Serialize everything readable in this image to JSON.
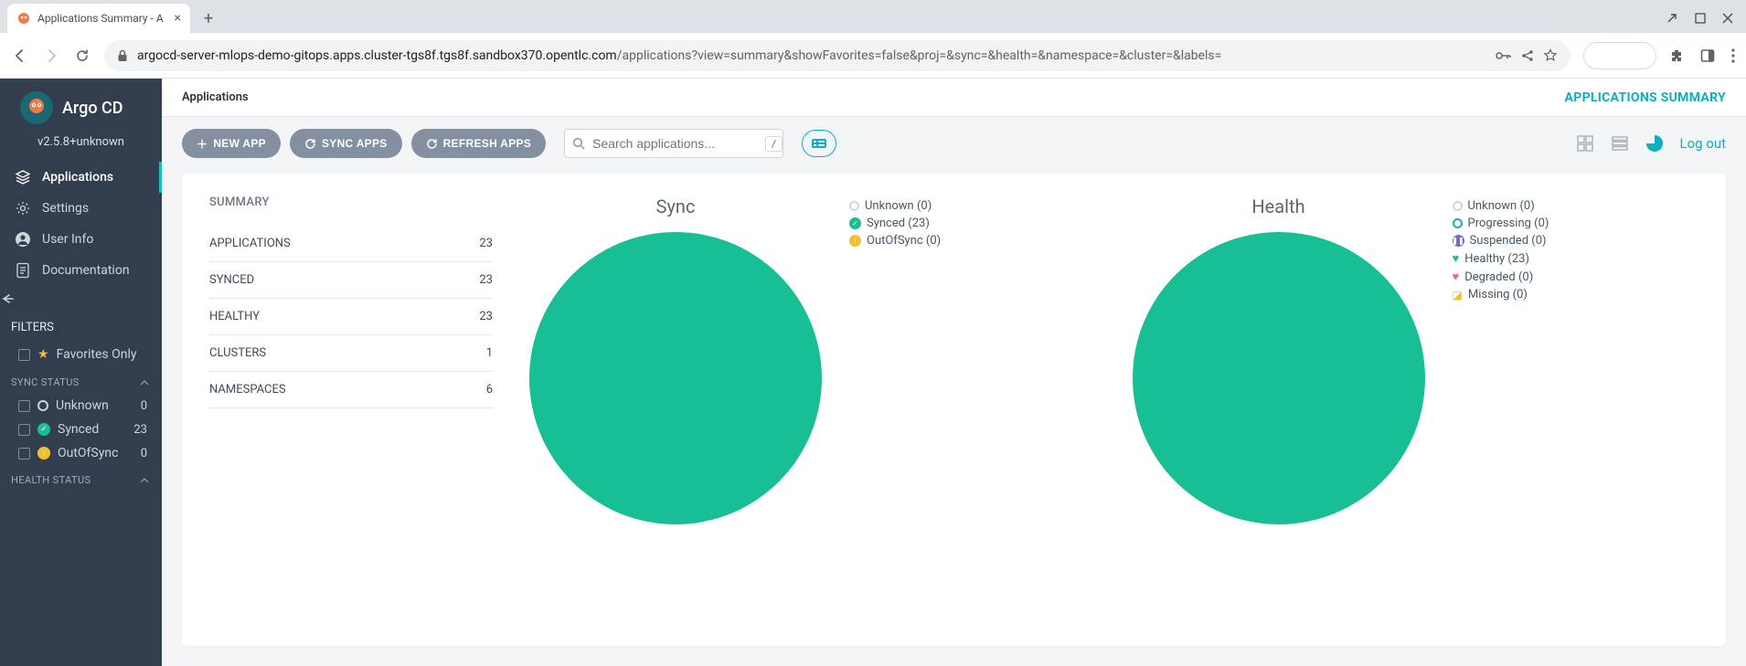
{
  "browser": {
    "tab_title": "Applications Summary - A",
    "url_host": "argocd-server-mlops-demo-gitops.apps.cluster-tgs8f.tgs8f.sandbox370.opentlc.com",
    "url_path": "/applications?view=summary&showFavorites=false&proj=&sync=&health=&namespace=&cluster=&labels="
  },
  "sidebar": {
    "brand": "Argo CD",
    "version": "v2.5.8+unknown",
    "nav": [
      {
        "label": "Applications",
        "active": true
      },
      {
        "label": "Settings",
        "active": false
      },
      {
        "label": "User Info",
        "active": false
      },
      {
        "label": "Documentation",
        "active": false
      }
    ],
    "filters_title": "FILTERS",
    "favorites_label": "Favorites Only",
    "sync_status_title": "SYNC STATUS",
    "sync_filters": [
      {
        "label": "Unknown",
        "count": "0",
        "kind": "ring"
      },
      {
        "label": "Synced",
        "count": "23",
        "kind": "green"
      },
      {
        "label": "OutOfSync",
        "count": "0",
        "kind": "amber"
      }
    ],
    "health_status_title": "HEALTH STATUS"
  },
  "header": {
    "breadcrumb": "Applications",
    "right_label": "APPLICATIONS SUMMARY"
  },
  "toolbar": {
    "new_app": "NEW APP",
    "sync_apps": "SYNC APPS",
    "refresh_apps": "REFRESH APPS",
    "search_placeholder": "Search applications...",
    "kbd": "/",
    "logout": "Log out"
  },
  "summary": {
    "title": "SUMMARY",
    "rows": [
      {
        "label": "APPLICATIONS",
        "value": "23"
      },
      {
        "label": "SYNCED",
        "value": "23"
      },
      {
        "label": "HEALTHY",
        "value": "23"
      },
      {
        "label": "CLUSTERS",
        "value": "1"
      },
      {
        "label": "NAMESPACES",
        "value": "6"
      }
    ]
  },
  "sync_chart": {
    "title": "Sync",
    "legend": [
      {
        "label": "Unknown (0)",
        "kind": "ring-grey"
      },
      {
        "label": "Synced (23)",
        "kind": "green-check"
      },
      {
        "label": "OutOfSync (0)",
        "kind": "amber-up"
      }
    ]
  },
  "health_chart": {
    "title": "Health",
    "legend": [
      {
        "label": "Unknown (0)",
        "kind": "ring-grey"
      },
      {
        "label": "Progressing (0)",
        "kind": "ring-blue"
      },
      {
        "label": "Suspended (0)",
        "kind": "purple-pause"
      },
      {
        "label": "Healthy (23)",
        "kind": "heart-green"
      },
      {
        "label": "Degraded (0)",
        "kind": "heart-red"
      },
      {
        "label": "Missing (0)",
        "kind": "box-amber"
      }
    ]
  },
  "chart_data": [
    {
      "type": "pie",
      "title": "Sync",
      "series": [
        {
          "name": "Unknown",
          "value": 0
        },
        {
          "name": "Synced",
          "value": 23
        },
        {
          "name": "OutOfSync",
          "value": 0
        }
      ]
    },
    {
      "type": "pie",
      "title": "Health",
      "series": [
        {
          "name": "Unknown",
          "value": 0
        },
        {
          "name": "Progressing",
          "value": 0
        },
        {
          "name": "Suspended",
          "value": 0
        },
        {
          "name": "Healthy",
          "value": 23
        },
        {
          "name": "Degraded",
          "value": 0
        },
        {
          "name": "Missing",
          "value": 0
        }
      ]
    }
  ]
}
